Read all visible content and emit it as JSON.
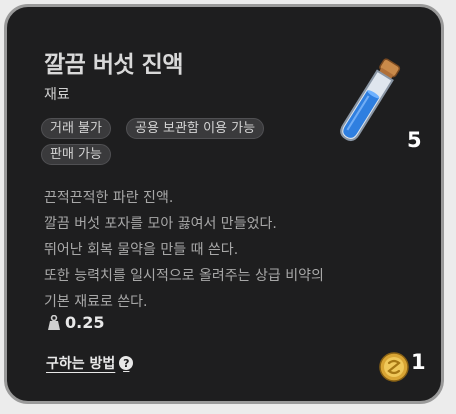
{
  "item": {
    "name": "깔끔 버섯 진액",
    "category": "재료",
    "tags": [
      "거래 불가",
      "공용 보관함 이용 가능",
      "판매 가능"
    ],
    "quantity": "5",
    "description_lines": [
      "끈적끈적한 파란 진액.",
      "깔끔 버섯 포자를 모아 끓여서 만들었다.",
      "뛰어난 회복 물약을 만들 때 쓴다.",
      "또한 능력치를 일시적으로 올려주는 상급 비약의",
      "기본 재료로 쓴다."
    ],
    "weight": "0.25",
    "icon": "blue-potion-vial-icon"
  },
  "footer": {
    "how_to_obtain_label": "구하는 방법",
    "help_icon_glyph": "?",
    "price": "1",
    "coin_icon": "gold-coin-icon"
  },
  "colors": {
    "background": "#1e1e1f",
    "border": "#9a9a9a",
    "tag_bg": "#3a3a3c",
    "potion_liquid": "#2f7fe0"
  }
}
